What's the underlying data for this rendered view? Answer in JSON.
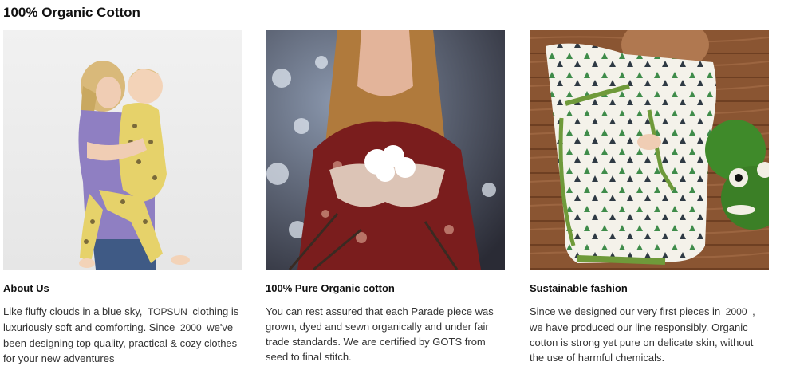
{
  "section": {
    "title": "100% Organic Cotton"
  },
  "cards": [
    {
      "heading": "About Us",
      "image_alt": "Mother holding baby in yellow pajamas",
      "text_a": "Like fluffy clouds in a blue sky, ",
      "brand": "TOPSUN",
      "text_b": " clothing is luxuriously soft and comforting. Since ",
      "year": "2000",
      "text_c": " we've been designing top quality, practical & cozy clothes for your new adventures"
    },
    {
      "heading": "100% Pure Organic cotton",
      "image_alt": "Hands holding raw cotton in a cotton field",
      "text": "You can rest assured that each Parade piece was grown, dyed and sewn organically and under fair trade standards. We are certified by GOTS from seed to final stitch."
    },
    {
      "heading": "Sustainable fashion",
      "image_alt": "Baby in tree-print sleep gown next to green crochet toy",
      "text_a": "Since we designed our very first pieces in ",
      "year": "2000",
      "text_b": " , we have produced our line responsibly. Organic cotton is strong yet pure on delicate skin, without the use of harmful chemicals."
    }
  ],
  "colors": {
    "text": "#111111",
    "body_text": "#333333",
    "accent_yellow": "#e6d26a",
    "accent_green": "#6f9a3a"
  }
}
